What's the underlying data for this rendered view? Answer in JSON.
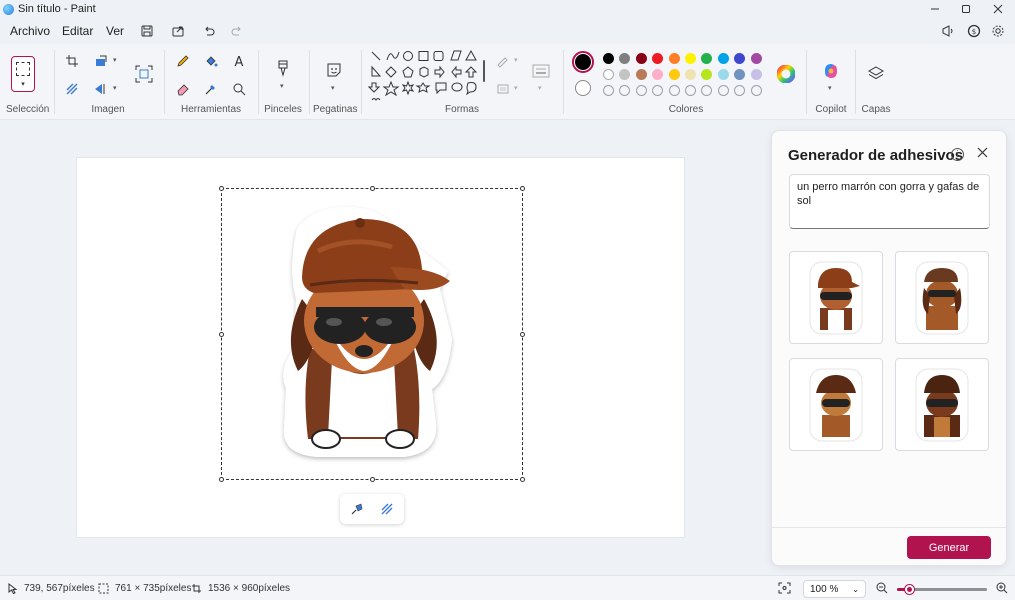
{
  "window": {
    "title": "Sin título - Paint",
    "minimize_icon": "minimize-icon",
    "maximize_icon": "maximize-icon",
    "close_icon": "close-icon"
  },
  "menu": {
    "items": [
      "Archivo",
      "Editar",
      "Ver"
    ],
    "quick_actions": [
      "save-icon",
      "share-icon",
      "undo-icon",
      "redo-icon"
    ],
    "right_tools": [
      "feedback-icon",
      "account-icon",
      "settings-icon"
    ]
  },
  "ribbon": {
    "groups": {
      "seleccion": "Selección",
      "imagen": "Imagen",
      "herramientas": "Herramientas",
      "pinceles": "Pinceles",
      "pegatinas": "Pegatinas",
      "formas": "Formas",
      "colores": "Colores",
      "copilot": "Copilot",
      "capas": "Capas"
    },
    "accent_color": "#b0134e",
    "palette_row1": [
      "#000000",
      "#7f7f7f",
      "#880015",
      "#ed1c24",
      "#ff7f27",
      "#fff200",
      "#22b14c",
      "#00a2e8",
      "#3f48cc",
      "#a349a4"
    ],
    "palette_row2": [
      "#ffffff",
      "#c3c3c3",
      "#b97a57",
      "#ffaec9",
      "#ffc90e",
      "#efe4b0",
      "#b5e61d",
      "#99d9ea",
      "#7092be",
      "#c8bfe7"
    ],
    "custom_swatches": 10
  },
  "sticker_panel": {
    "title": "Generador de adhesivos",
    "prompt": "un perro marrón con gorra y gafas de sol",
    "generate_label": "Generar",
    "info_icon": "info-icon",
    "close_icon": "close-icon"
  },
  "statusbar": {
    "cursor_position": "739, 567píxeles",
    "selection_size": "761 × 735píxeles",
    "canvas_size": "1536 × 960píxeles",
    "zoom": "100 %",
    "zoom_fraction": 0.15
  }
}
